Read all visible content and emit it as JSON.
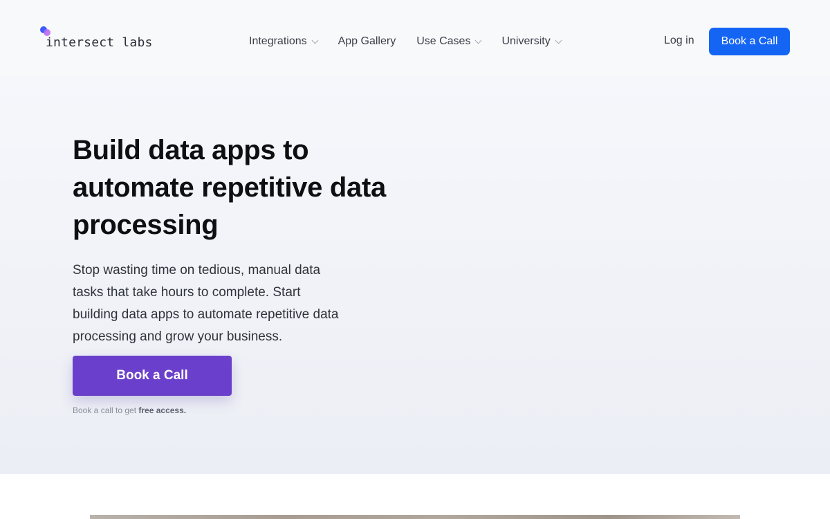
{
  "brand": {
    "name": "intersect labs"
  },
  "nav": {
    "items": [
      {
        "label": "Integrations",
        "has_dropdown": true
      },
      {
        "label": "App Gallery",
        "has_dropdown": false
      },
      {
        "label": "Use Cases",
        "has_dropdown": true
      },
      {
        "label": "University",
        "has_dropdown": true
      }
    ],
    "login_label": "Log in",
    "cta_label": "Book a Call"
  },
  "hero": {
    "title": "Build data apps to automate repetitive data processing",
    "description": "Stop wasting time on tedious, manual data tasks that take hours to complete. Start building data apps to automate repetitive data processing and grow your business.",
    "cta_label": "Book a Call",
    "note_prefix": "Book a call to get ",
    "note_emphasis": "free access."
  },
  "colors": {
    "header_cta": "#1565f5",
    "hero_cta": "#6a3fcb",
    "logo_dot_blue": "#3b5bff",
    "logo_dot_purple": "#b86cf0"
  },
  "icons": {
    "dropdown": "chevron-down-icon",
    "logo": "logo-mark-icon"
  }
}
